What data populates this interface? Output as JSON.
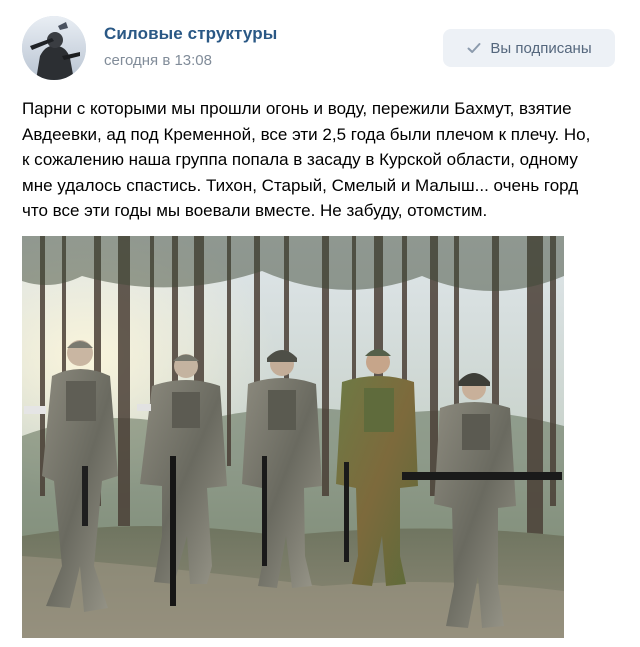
{
  "post": {
    "group_name": "Силовые структуры",
    "time": "сегодня в 13:08",
    "subscribe_button": {
      "label": "Вы подписаны",
      "icon": "check-icon"
    },
    "text_lines": [
      "Парни с которыми мы прошли огонь и воду, пережили Бахмут, взятие",
      "Авдеевки, ад под Кременной, все эти 2,5 года были плечом к плечу. Но,",
      "к сожалению наша группа попала в засаду в Курской области, одному",
      "мне удалось спастись. Тихон, Старый, Смелый и Малыш... очень горд",
      "что все эти годы мы воевали вместе. Не забуду, отомстим."
    ],
    "avatar_icon": "group-avatar",
    "photo_icon": "group-photo-soldiers-in-forest"
  },
  "colors": {
    "group_name": "#2a5885",
    "meta_text": "#818c99",
    "button_bg": "#edf1f6",
    "button_text": "#55677d"
  }
}
